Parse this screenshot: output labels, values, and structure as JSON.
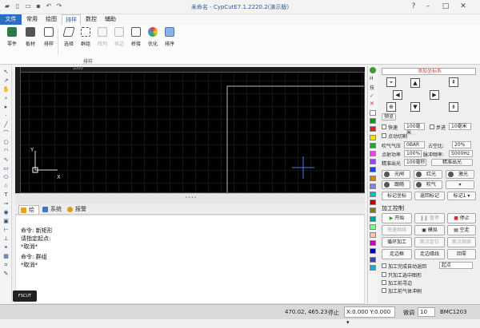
{
  "window": {
    "title": "未命名 - CypCutE7.1.2220.2(演示版)"
  },
  "menu": {
    "tabs": [
      "文件",
      "常用",
      "绘图",
      "排样",
      "数控",
      "辅助"
    ]
  },
  "ribbon": {
    "buttons": [
      {
        "label": "零件",
        "icon": "part-icon",
        "disabled": false
      },
      {
        "label": "板材",
        "icon": "sheet-icon",
        "disabled": false
      },
      {
        "label": "排样",
        "icon": "nesting-icon",
        "disabled": false
      },
      {
        "label": "选择",
        "icon": "select-icon",
        "disabled": false
      },
      {
        "label": "群组",
        "icon": "group-icon",
        "disabled": false
      },
      {
        "label": "阵列",
        "icon": "array-icon",
        "disabled": true
      },
      {
        "label": "共边",
        "icon": "common-edge-icon",
        "disabled": true
      },
      {
        "label": "桥接",
        "icon": "bridge-icon",
        "disabled": false
      },
      {
        "label": "优化",
        "icon": "optimize-icon",
        "disabled": false
      },
      {
        "label": "排序",
        "icon": "sort-icon",
        "disabled": false
      }
    ],
    "group_label": "排样"
  },
  "canvas": {
    "ruler_label": "1000",
    "axis_x": "X",
    "axis_y": "Y"
  },
  "bottom_tabs": [
    "绘图",
    "系统",
    "报警"
  ],
  "console": {
    "lines": [
      "命令: 新矩形",
      "请指定起点:",
      "*取消*",
      "命令: 群组",
      "*取消*"
    ],
    "logo": "FSCUT"
  },
  "right_panel": {
    "header": "添加坐标系",
    "btn_test": "预览",
    "fast_label": "快速",
    "fast_value": "100毫米",
    "step_label": "步进",
    "step_value": "10毫米",
    "spot_label": "点动切割",
    "gas_label": "吹气气压",
    "gas_value": "0BAR",
    "ratio_label": "占空比:",
    "ratio_value": "20%",
    "power_label": "点射功率",
    "power_value": "100%",
    "freq_label": "脉冲频率:",
    "freq_value": "5000Hz",
    "fine_label": "精准出光",
    "fine_value": "100毫秒",
    "fine_btn": "精准出光",
    "row1": [
      "光闸",
      "红光",
      "激光"
    ],
    "row2": [
      "跟随",
      "吹气"
    ],
    "row3": [
      "标记坐标",
      "返回标记",
      "标记1"
    ],
    "section": "加工控制",
    "ctrl1": [
      "开始",
      "暂停",
      "停止"
    ],
    "ctrl2": [
      "快速继续",
      "模拟",
      "空走"
    ],
    "ctrl3": [
      "循环加工",
      "断点定位",
      "断点继续"
    ],
    "ctrl4": [
      "走边框",
      "走边缘线",
      "回零"
    ],
    "opt1": "加工完成自动返回",
    "opt1_sel": "起点",
    "opts": [
      "只加工选中图形",
      "加工前寻边",
      "加工前气体冲刷"
    ]
  },
  "status": {
    "coords": "470.02, 465.23",
    "state": "停止",
    "xy": "X:0.000 Y:0.000",
    "fine_label": "微调",
    "fine_value": "10",
    "device": "BMC1203"
  },
  "colors": {
    "accent": "#2d6fbf",
    "canvas_bg": "#000000",
    "grid": "#3a3a3a"
  },
  "swatches": [
    "#ffffff",
    "#00a000",
    "#e02020",
    "#f0e000",
    "#30a030",
    "#f040f0",
    "#a040f0",
    "#2040e0",
    "#e08000",
    "#8080ff",
    "#00c0c0",
    "#c00000",
    "#808000",
    "#00a0a0",
    "#80ff80",
    "#ffc0c0",
    "#c000c0",
    "#0000a0",
    "#4040c0",
    "#00b0ff"
  ]
}
